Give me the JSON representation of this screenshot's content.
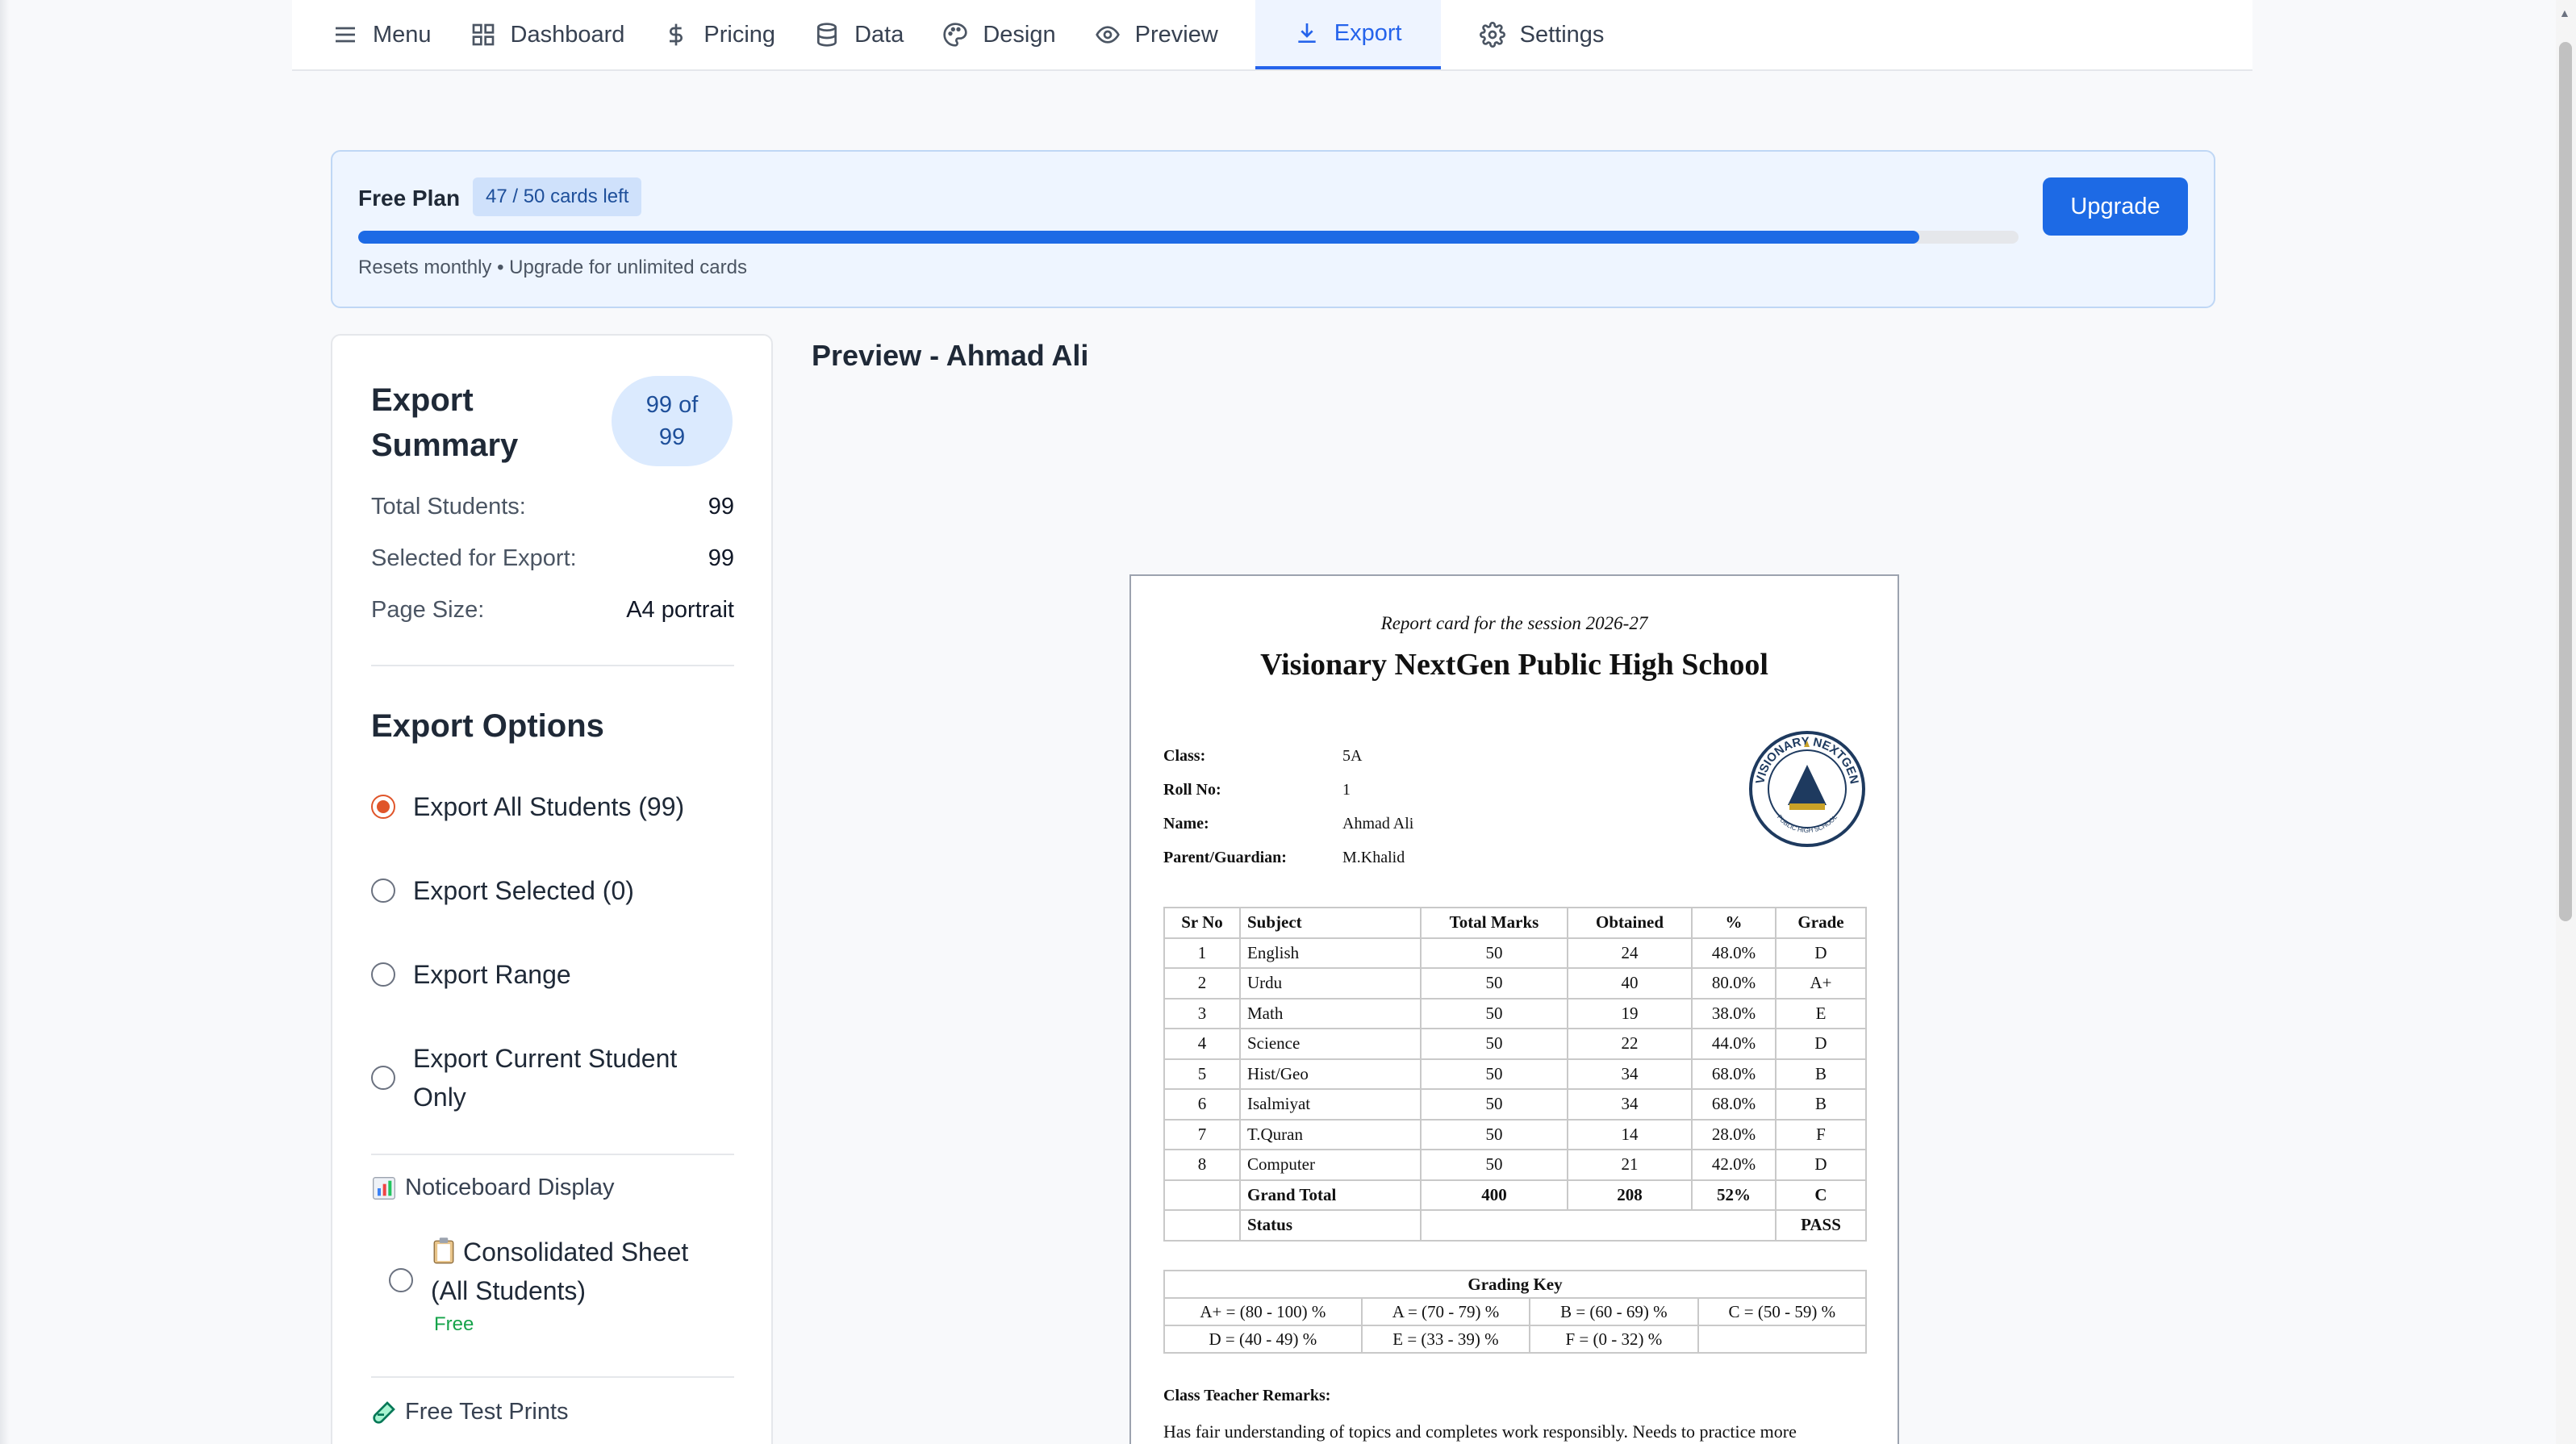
{
  "nav": {
    "items": [
      {
        "label": "Menu",
        "icon": "menu-icon"
      },
      {
        "label": "Dashboard",
        "icon": "dashboard-icon"
      },
      {
        "label": "Pricing",
        "icon": "dollar-icon"
      },
      {
        "label": "Data",
        "icon": "database-icon"
      },
      {
        "label": "Design",
        "icon": "palette-icon"
      },
      {
        "label": "Preview",
        "icon": "eye-icon"
      },
      {
        "label": "Export",
        "icon": "download-icon",
        "active": true
      },
      {
        "label": "Settings",
        "icon": "gear-icon"
      }
    ]
  },
  "plan": {
    "title": "Free Plan",
    "badge": "47 / 50 cards left",
    "used_fraction": 0.94,
    "note": "Resets monthly • Upgrade for unlimited cards",
    "upgrade_label": "Upgrade",
    "accent": "#1d6ae5"
  },
  "summary": {
    "title": "Export Summary",
    "count": "99 of 99",
    "rows": [
      {
        "label": "Total Students:",
        "value": "99"
      },
      {
        "label": "Selected for Export:",
        "value": "99"
      },
      {
        "label": "Page Size:",
        "value": "A4 portrait"
      }
    ]
  },
  "options": {
    "title": "Export Options",
    "radios": [
      {
        "label": "Export All Students (99)",
        "selected": true
      },
      {
        "label": "Export Selected (0)",
        "selected": false
      },
      {
        "label": "Export Range",
        "selected": false
      },
      {
        "label": "Export Current Student Only",
        "selected": false
      }
    ],
    "noticeboard_label": "Noticeboard Display",
    "consolidated_label": "Consolidated Sheet (All Students)",
    "consolidated_tag": "Free",
    "free_test_label": "Free Test Prints"
  },
  "preview": {
    "title": "Preview - Ahmad Ali",
    "session": "Report card for the session 2026-27",
    "school": "Visionary NextGen Public High School",
    "info": [
      {
        "label": "Class:",
        "value": "5A"
      },
      {
        "label": "Roll No:",
        "value": "1"
      },
      {
        "label": "Name:",
        "value": "Ahmad Ali"
      },
      {
        "label": "Parent/Guardian:",
        "value": "M.Khalid"
      }
    ],
    "logo_text_top": "VISIONARY NEXTGEN",
    "logo_text_bottom": "PUBLIC HIGH SCHOOL",
    "headers": [
      "Sr No",
      "Subject",
      "Total Marks",
      "Obtained",
      "%",
      "Grade"
    ],
    "rows": [
      [
        "1",
        "English",
        "50",
        "24",
        "48.0%",
        "D"
      ],
      [
        "2",
        "Urdu",
        "50",
        "40",
        "80.0%",
        "A+"
      ],
      [
        "3",
        "Math",
        "50",
        "19",
        "38.0%",
        "E"
      ],
      [
        "4",
        "Science",
        "50",
        "22",
        "44.0%",
        "D"
      ],
      [
        "5",
        "Hist/Geo",
        "50",
        "34",
        "68.0%",
        "B"
      ],
      [
        "6",
        "Isalmiyat",
        "50",
        "34",
        "68.0%",
        "B"
      ],
      [
        "7",
        "T.Quran",
        "50",
        "14",
        "28.0%",
        "F"
      ],
      [
        "8",
        "Computer",
        "50",
        "21",
        "42.0%",
        "D"
      ]
    ],
    "total": {
      "label": "Grand Total",
      "total": "400",
      "obtained": "208",
      "pct": "52%",
      "grade": "C"
    },
    "status": {
      "label": "Status",
      "value": "PASS"
    },
    "grading_title": "Grading Key",
    "grading": [
      [
        "A+ = (80 - 100) %",
        "A = (70 - 79) %",
        "B = (60 - 69) %",
        "C = (50 - 59) %"
      ],
      [
        "D = (40 - 49) %",
        "E = (33 - 39) %",
        "F = (0 - 32) %",
        ""
      ]
    ],
    "remarks_label": "Class Teacher Remarks:",
    "remarks": "Has fair understanding of topics and completes work responsibly. Needs to practice more"
  }
}
